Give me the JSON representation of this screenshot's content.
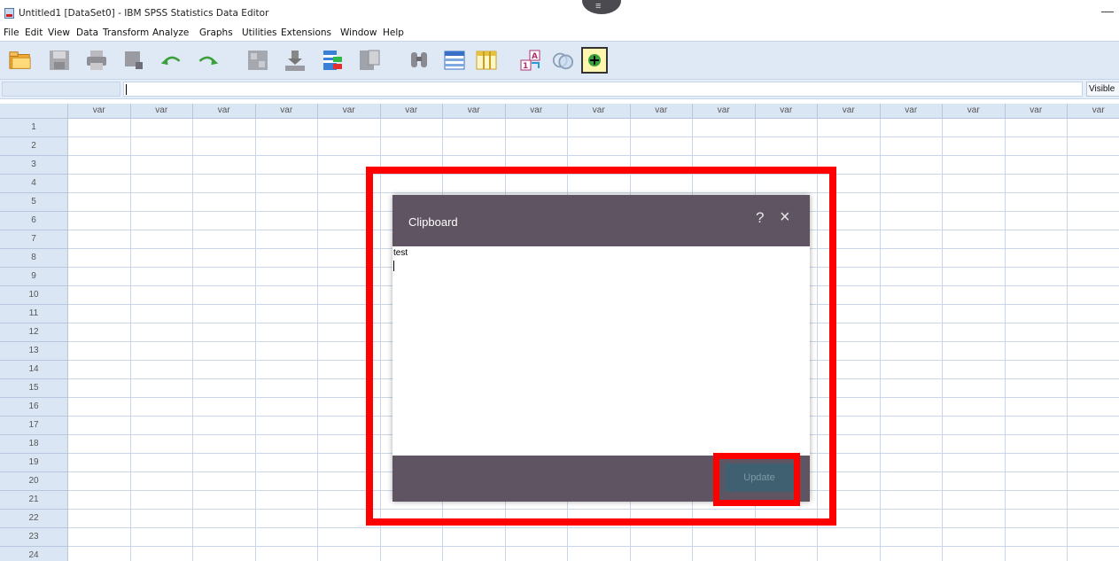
{
  "window": {
    "title": "Untitled1 [DataSet0] - IBM SPSS Statistics Data Editor",
    "handle_glyph": "≡",
    "minimize_glyph": "—"
  },
  "menu": [
    "File",
    "Edit",
    "View",
    "Data",
    "Transform",
    "Analyze",
    "Graphs",
    "Utilities",
    "Extensions",
    "Window",
    "Help"
  ],
  "toolbar": {
    "icons": [
      "open-icon",
      "save-icon",
      "print-icon",
      "dialog-recall-icon",
      "undo-icon",
      "redo-icon",
      "goto-case-icon",
      "goto-variable-icon",
      "variables-icon",
      "run-descriptives-icon",
      "find-icon",
      "insert-cases-icon",
      "insert-variable-icon",
      "split-file-icon",
      "select-cases-icon",
      "value-labels-icon",
      "use-sets-icon",
      "show-all-variables-icon"
    ]
  },
  "editor": {
    "cell_reference": "",
    "cell_value": "",
    "visible_label": "Visible"
  },
  "grid": {
    "column_label": "var",
    "columns": [
      "var",
      "var",
      "var",
      "var",
      "var",
      "var",
      "var",
      "var",
      "var",
      "var",
      "var",
      "var",
      "var",
      "var",
      "var",
      "var",
      "var"
    ],
    "rows": [
      "1",
      "2",
      "3",
      "4",
      "5",
      "6",
      "7",
      "8",
      "9",
      "10",
      "11",
      "12",
      "13",
      "14",
      "15",
      "16",
      "17",
      "18",
      "19",
      "20",
      "21",
      "22",
      "23",
      "24"
    ]
  },
  "dialog": {
    "title": "Clipboard",
    "help_glyph": "?",
    "close_glyph": "×",
    "content": "test",
    "update_label": "Update"
  },
  "colors": {
    "dialog_bg": "#5e5462",
    "update_button_bg": "#3f6070",
    "highlight": "#ff0000",
    "toolbar_bg": "#dfe9f6",
    "header_bg": "#dbe6f4"
  }
}
